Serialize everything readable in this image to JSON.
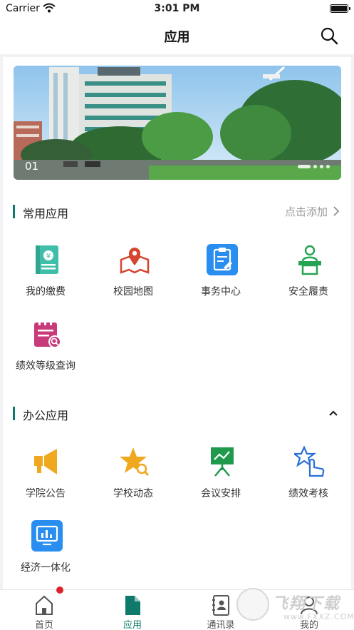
{
  "status_bar": {
    "carrier": "Carrier",
    "time": "3:01 PM"
  },
  "nav": {
    "title": "应用"
  },
  "banner": {
    "page_number": "01",
    "dot_count": 4,
    "active_dot": 0
  },
  "common_section": {
    "title": "常用应用",
    "add_label": "点击添加",
    "items": [
      {
        "label": "我的缴费",
        "icon": "payment-book-icon"
      },
      {
        "label": "校园地图",
        "icon": "map-pin-icon"
      },
      {
        "label": "事务中心",
        "icon": "clipboard-icon"
      },
      {
        "label": "安全履责",
        "icon": "person-podium-icon"
      },
      {
        "label": "绩效等级查询",
        "icon": "calendar-search-icon"
      }
    ]
  },
  "office_section": {
    "title": "办公应用",
    "items": [
      {
        "label": "学院公告",
        "icon": "megaphone-icon"
      },
      {
        "label": "学校动态",
        "icon": "star-search-icon"
      },
      {
        "label": "会议安排",
        "icon": "presentation-board-icon"
      },
      {
        "label": "绩效考核",
        "icon": "star-hand-icon"
      },
      {
        "label": "经济一体化",
        "icon": "monitor-chart-icon"
      }
    ]
  },
  "tabs": [
    {
      "label": "首页",
      "icon": "home-icon"
    },
    {
      "label": "应用",
      "icon": "document-icon",
      "active": true
    },
    {
      "label": "通讯录",
      "icon": "contacts-icon"
    },
    {
      "label": "我的",
      "icon": "profile-icon"
    }
  ],
  "watermark": {
    "main": "飞翔下载",
    "sub": "www.FXXZ.COM"
  },
  "colors": {
    "accent": "#0e7a6c",
    "badge": "#e0222c",
    "background": "#f2f2f4"
  }
}
